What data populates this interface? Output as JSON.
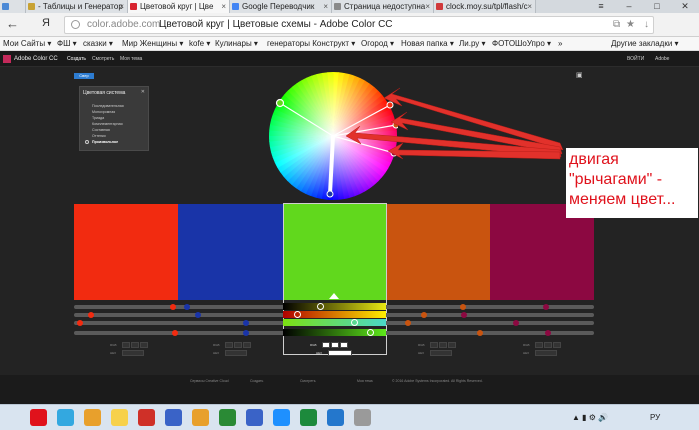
{
  "browser": {
    "tabs": [
      {
        "label": "",
        "fav": "#4c8ad6"
      },
      {
        "label": "- Таблицы и Генератор",
        "fav": "#c8a233"
      },
      {
        "label": "Цветовой круг | Цве",
        "fav": "#d8242f",
        "active": true
      },
      {
        "label": "Google Переводчик",
        "fav": "#4285f4"
      },
      {
        "label": "Страница недоступна",
        "fav": "#8a8a8a"
      },
      {
        "label": "clock.moy.su/tpl/flash/c",
        "fav": "#d0393b"
      }
    ],
    "window_buttons": [
      "≡",
      "–",
      "□",
      "✕"
    ],
    "url": "color.adobe.com",
    "page_title": "Цветовой круг | Цветовые схемы - Adobe Color CC",
    "back_icon": "arrow-left-icon",
    "yandex_label": "Я",
    "bookmarks": [
      "Мои Сайты ▾",
      "ФШ ▾",
      "сказки ▾",
      "Мир Женщины ▾",
      "kofe ▾",
      "Кулинары ▾",
      "генераторы Конструкт ▾",
      "Огород ▾",
      "Новая папка ▾",
      "Ли.ру ▾",
      "ФОТОШоУпро ▾",
      "»",
      "Другие закладки ▾"
    ]
  },
  "adobe": {
    "brand": "Adobe Color CC",
    "nav": [
      "Создать",
      "Смотреть",
      "Моя тема"
    ],
    "signin": "ВОЙТИ",
    "adobe_label": "Adobe",
    "blue_button": "Свер",
    "rules_panel": {
      "title": "Цветовая система",
      "options": [
        "Последовательная",
        "Монохромная",
        "Триада",
        "Комплементарная",
        "Составная",
        "Оттенки",
        "Произвольное"
      ],
      "selected": "Произвольное"
    },
    "swatches": [
      {
        "color": "#f22b10"
      },
      {
        "color": "#1934a8"
      },
      {
        "color": "#61d81d"
      },
      {
        "color": "#c9540f"
      },
      {
        "color": "#8c0841"
      }
    ],
    "value_boxes": [
      {
        "label": "RGB",
        "value": "",
        "pos": 0
      },
      {
        "label": "HEX",
        "value": "",
        "pos": 0
      },
      {
        "label": "RGB",
        "value": "",
        "pos": 1
      },
      {
        "label": "HEX",
        "value": "",
        "pos": 1
      },
      {
        "label": "RGB",
        "value": "",
        "pos": 2
      },
      {
        "label": "HEX",
        "value": "",
        "pos": 2
      },
      {
        "label": "RGB",
        "value": "",
        "pos": 3
      },
      {
        "label": "HEX",
        "value": "",
        "pos": 3
      },
      {
        "label": "RGB",
        "value": "",
        "pos": 4
      },
      {
        "label": "HEX",
        "value": "",
        "pos": 4
      }
    ],
    "footer": {
      "copyright": "© 2016 Adobe Systems Incorporated. All Rights Reserved.",
      "col1": "Создать",
      "col2": "Смотреть",
      "col3": "Моя тема",
      "cc_label": "Сервисы Creative Cloud"
    }
  },
  "annotation": {
    "text": "двигая \"рычагами\" - меняем цвет..."
  },
  "taskbar": {
    "icons": [
      "#e0121c",
      "#33a8e0",
      "#e8a02c",
      "#f7d14b",
      "#cf3028",
      "#3a63c7",
      "#e8a02c",
      "#2a8a35",
      "#3a63c7",
      "#1e90ff",
      "#1d8a3c",
      "#2477cc",
      "#9a9a9a"
    ],
    "lang": "РУ",
    "time": ""
  }
}
